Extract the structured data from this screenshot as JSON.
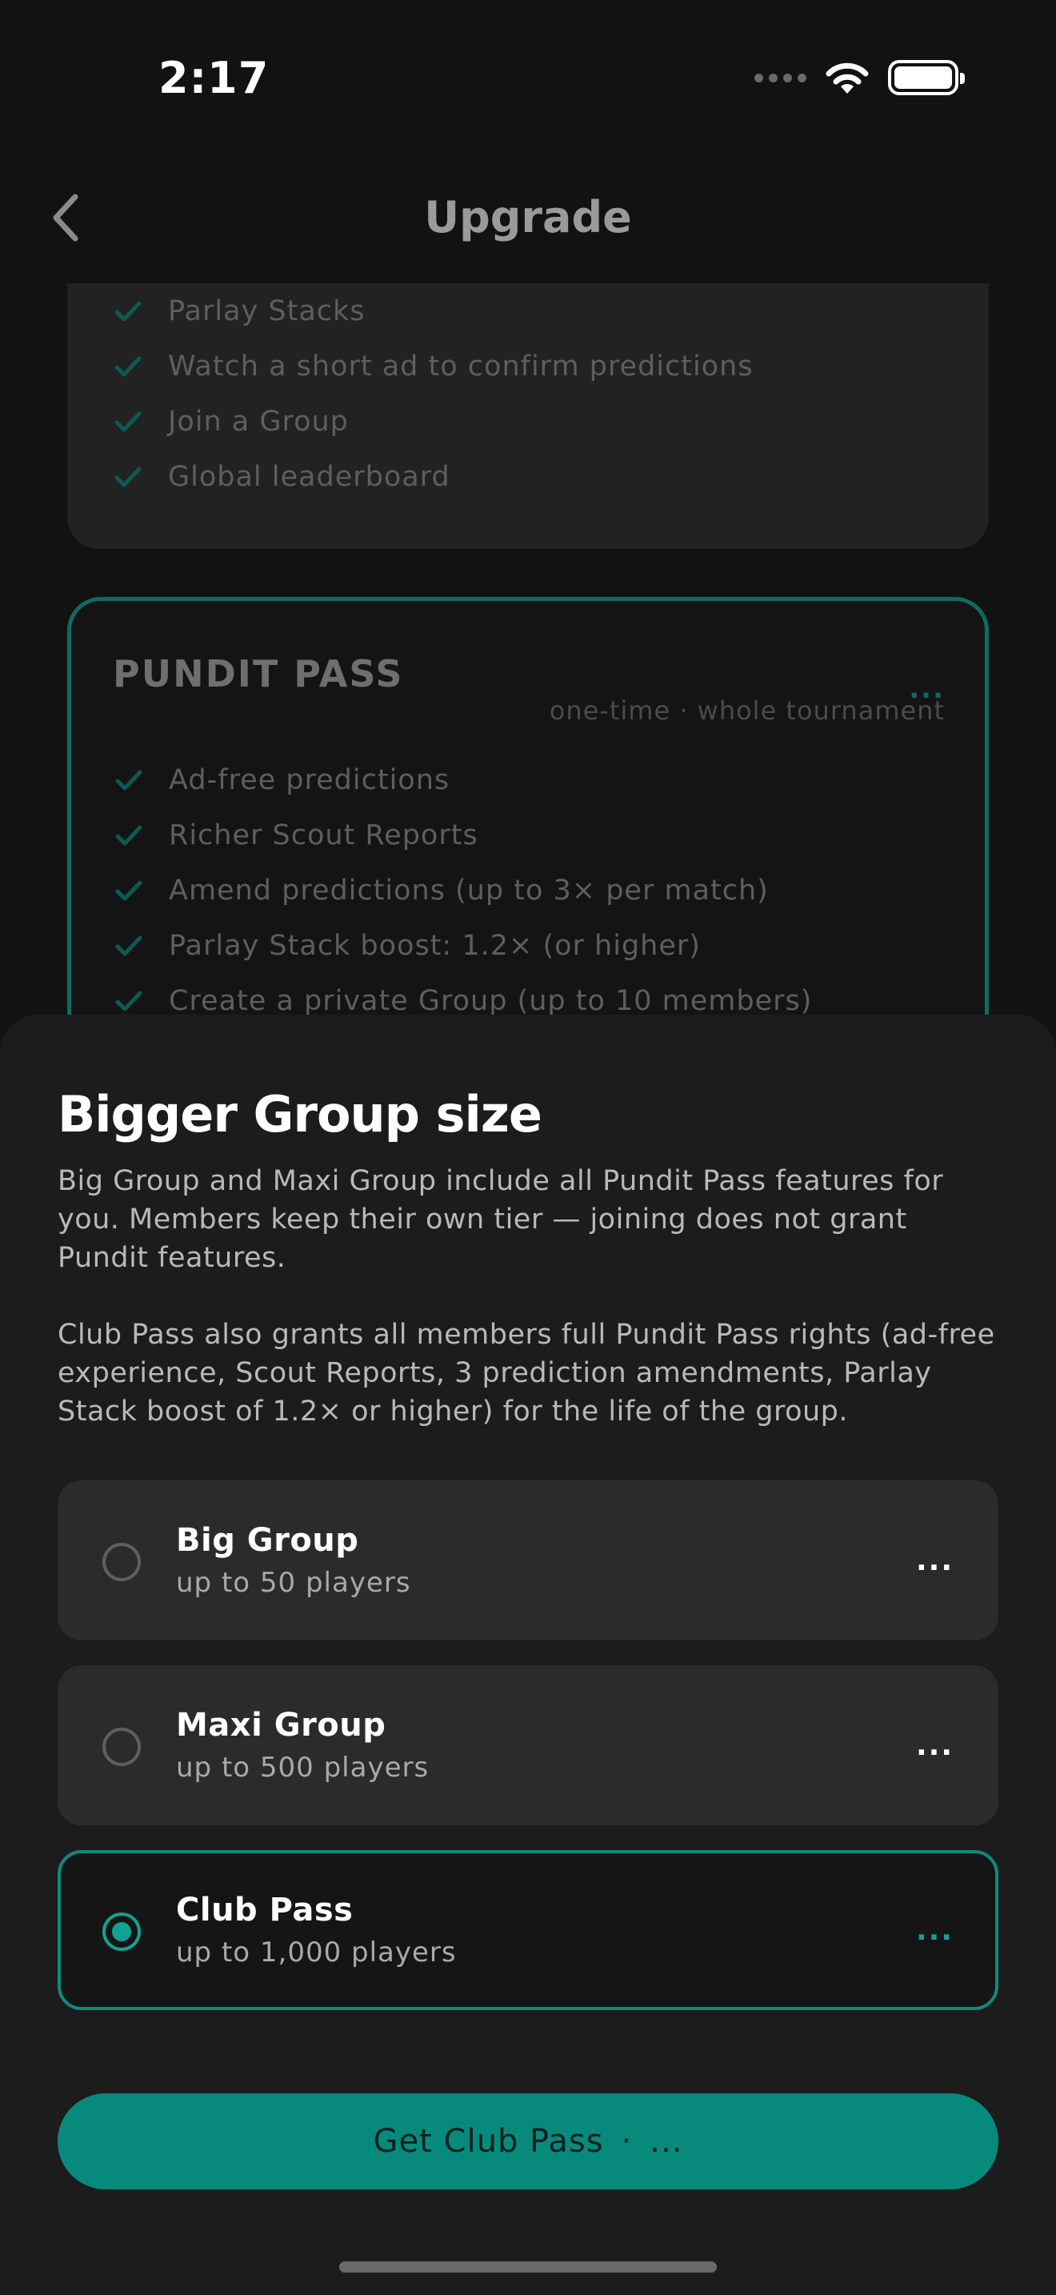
{
  "status_bar": {
    "time": "2:17"
  },
  "nav": {
    "title": "Upgrade"
  },
  "free_card": {
    "features": [
      "Parlay Stacks",
      "Watch a short ad to confirm predictions",
      "Join a Group",
      "Global leaderboard"
    ]
  },
  "pundit_card": {
    "title": "PUNDIT PASS",
    "price": "...",
    "subtitle": "one-time · whole tournament",
    "features": [
      "Ad-free predictions",
      "Richer Scout Reports",
      "Amend predictions (up to 3× per match)",
      "Parlay Stack boost: 1.2× (or higher)",
      "Create a private Group (up to 10 members)"
    ]
  },
  "sheet": {
    "title": "Bigger Group size",
    "description_1": "Big Group and Maxi Group include all Pundit Pass features for you. Members keep their own tier — joining does not grant Pundit features.",
    "description_2": "Club Pass also grants all members full Pundit Pass rights (ad-free experience, Scout Reports, 3 prediction amendments, Parlay Stack boost of 1.2× or higher) for the life of the group.",
    "options": [
      {
        "name": "Big Group",
        "subtitle": "up to 50 players",
        "price": "...",
        "selected": false
      },
      {
        "name": "Maxi Group",
        "subtitle": "up to 500 players",
        "price": "...",
        "selected": false
      },
      {
        "name": "Club Pass",
        "subtitle": "up to 1,000 players",
        "price": "...",
        "selected": true
      }
    ],
    "cta": {
      "label": "Get Club Pass",
      "separator": "·",
      "price": "..."
    }
  },
  "colors": {
    "accent": "#0e8a7e",
    "background": "#121212",
    "sheet": "#1c1c1c"
  },
  "icons": [
    "back-chevron-icon",
    "wifi-icon",
    "battery-icon",
    "check-icon",
    "radio-icon"
  ]
}
